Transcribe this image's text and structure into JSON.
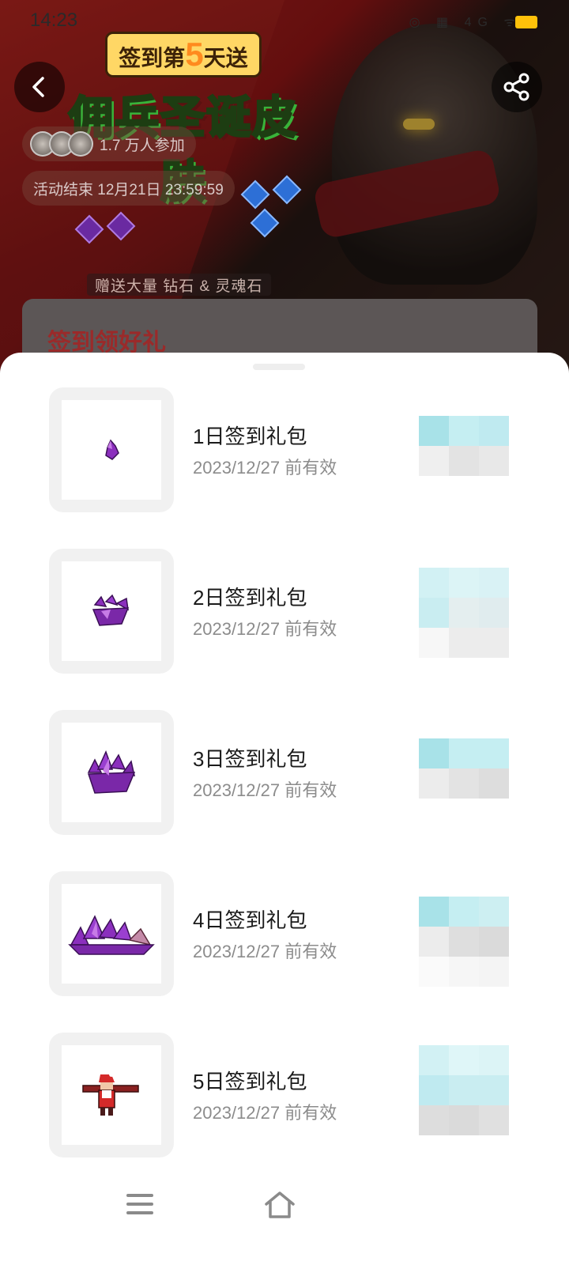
{
  "status_bar": {
    "time": "14:23",
    "icons": "◎ ▦ 4G ᯤ"
  },
  "banner": {
    "title_pre": "签到第",
    "title_num": "5",
    "title_post": "天送",
    "headline_a": "佣兵",
    "headline_hl": "圣诞",
    "headline_b": "皮肤",
    "participants": "1.7 万人参加",
    "end_time": "活动结束 12月21日 23:59:59",
    "caption": "赠送大量 钻石 & 灵魂石"
  },
  "section": {
    "title": "签到领好礼"
  },
  "rewards": [
    {
      "title": "1日签到礼包",
      "valid": "2023/12/27 前有效",
      "icon": "small-purple-crystal-icon"
    },
    {
      "title": "2日签到礼包",
      "valid": "2023/12/27 前有效",
      "icon": "purple-crystal-cluster-icon"
    },
    {
      "title": "3日签到礼包",
      "valid": "2023/12/27 前有效",
      "icon": "large-purple-crystal-icon"
    },
    {
      "title": "4日签到礼包",
      "valid": "2023/12/27 前有效",
      "icon": "purple-crystal-pile-icon"
    },
    {
      "title": "5日签到礼包",
      "valid": "2023/12/27 前有效",
      "icon": "santa-mercenary-skin-icon"
    }
  ],
  "colors": {
    "accent": "#ffc10a",
    "sheet": "#ffffff",
    "title_red": "#9a2a2a"
  }
}
